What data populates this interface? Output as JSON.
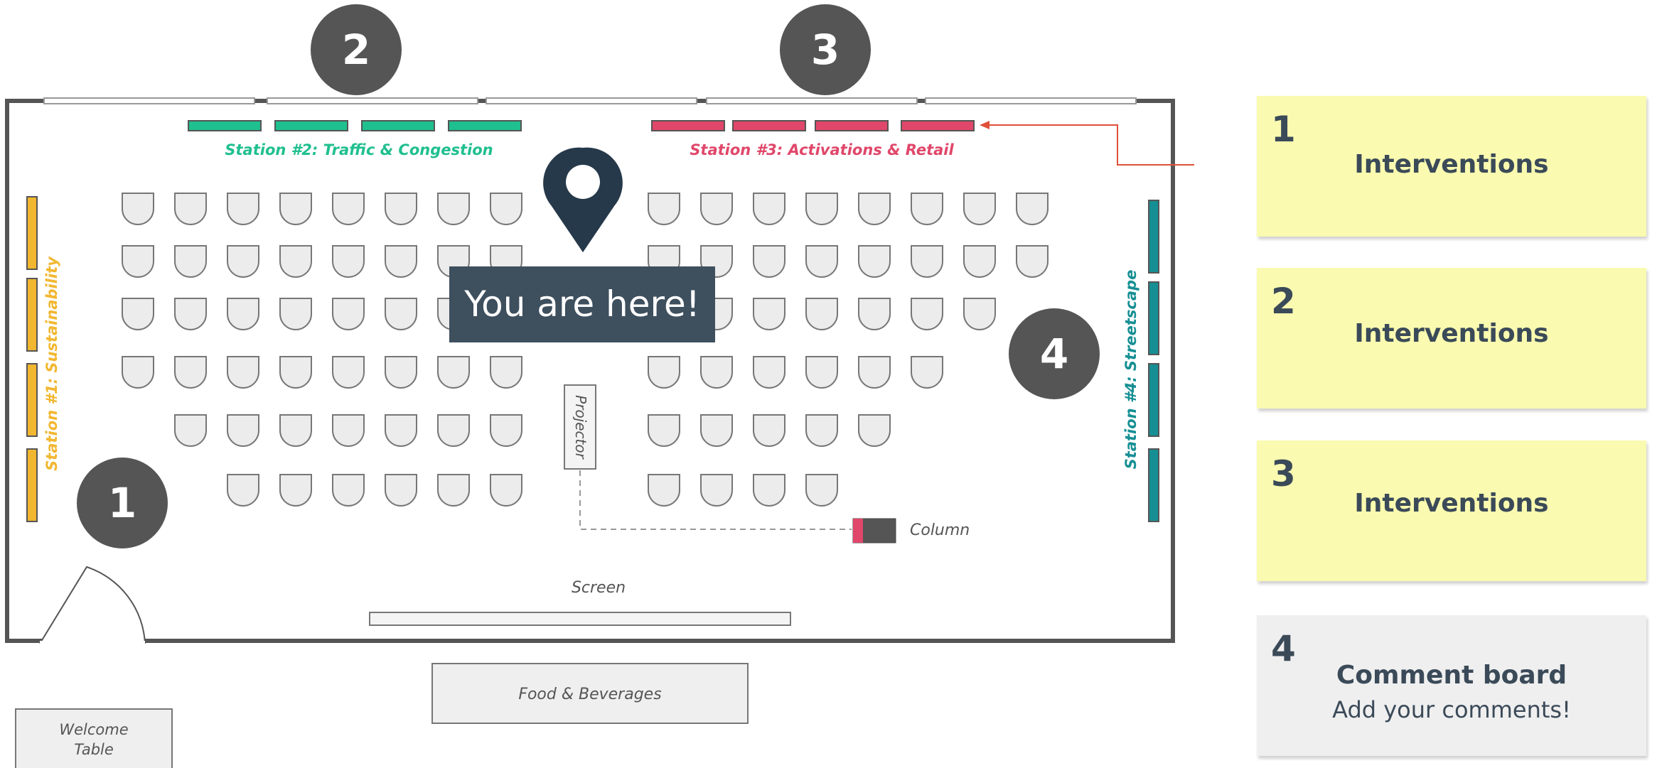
{
  "stations": {
    "station1": {
      "label": "Station #1: Sustainability",
      "color": "#f2b730"
    },
    "station2": {
      "label": "Station #2: Traffic & Congestion",
      "color": "#1fbf8f"
    },
    "station3": {
      "label": "Station #3: Activations & Retail",
      "color": "#e0476a"
    },
    "station4": {
      "label": "Station #4: Streetscape",
      "color": "#168f94"
    }
  },
  "badges": {
    "b1": "1",
    "b2": "2",
    "b3": "3",
    "b4": "4"
  },
  "labels": {
    "projector": "Projector",
    "column": "Column",
    "screen": "Screen",
    "food": "Food & Beverages",
    "welcome_line1": "Welcome",
    "welcome_line2": "Table"
  },
  "you_are_here": "You are here!",
  "sticky_notes": [
    {
      "number": "1",
      "title": "Interventions",
      "color": "#fafab0"
    },
    {
      "number": "2",
      "title": "Interventions",
      "color": "#fafab0"
    },
    {
      "number": "3",
      "title": "Interventions",
      "color": "#fafab0"
    },
    {
      "number": "4",
      "title": "Comment board",
      "subtitle": "Add your comments!",
      "color": "#efefef"
    }
  ],
  "colors": {
    "wall": "#555555",
    "badge": "#555555",
    "marker": "#26394a",
    "arrow": "#e0503a",
    "chair_fill": "#ececec",
    "chair_stroke": "#777777"
  }
}
